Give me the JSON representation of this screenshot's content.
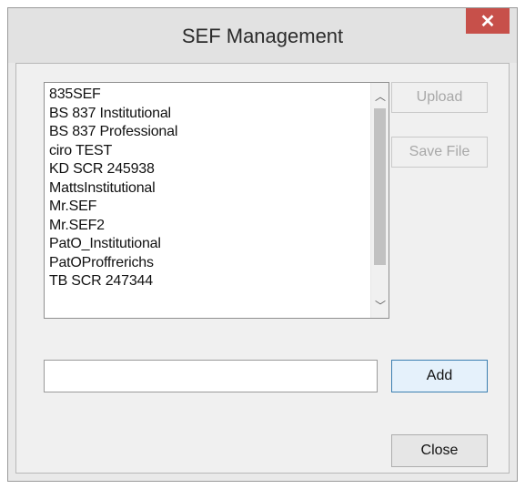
{
  "window": {
    "title": "SEF Management",
    "close_glyph": "✕"
  },
  "list": {
    "items": [
      "835SEF",
      "BS 837 Institutional",
      "BS 837 Professional",
      "ciro TEST",
      "KD SCR 245938",
      "MattsInstitutional",
      "Mr.SEF",
      "Mr.SEF2",
      "PatO_Institutional",
      "PatOProffrerichs",
      "TB SCR 247344"
    ],
    "scroll_up_glyph": "︿",
    "scroll_down_glyph": "﹀"
  },
  "buttons": {
    "upload": "Upload",
    "save_file": "Save File",
    "add": "Add",
    "close": "Close"
  },
  "input": {
    "value": ""
  },
  "colors": {
    "close_button": "#c7504a",
    "accent_border": "#3c7fb1"
  }
}
